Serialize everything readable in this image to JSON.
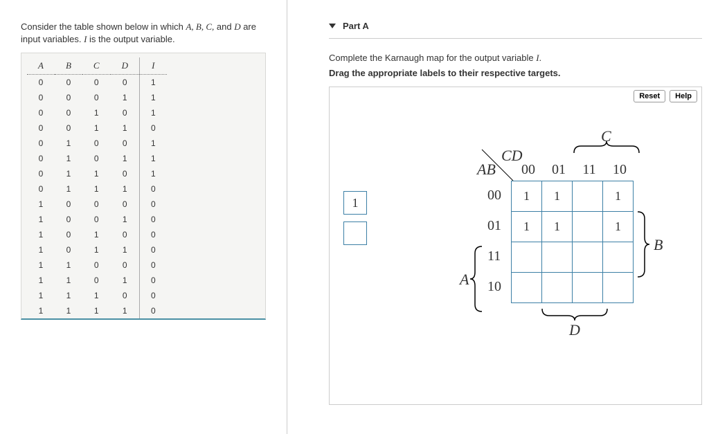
{
  "problem": {
    "text_before": "Consider the table shown below in which ",
    "vars": "A, B, C,",
    "text_mid1": " and ",
    "var_d": "D",
    "text_mid2": " are input variables. ",
    "var_i": "I",
    "text_after": " is the output variable."
  },
  "truth_table": {
    "headers": [
      "A",
      "B",
      "C",
      "D",
      "I"
    ],
    "rows": [
      [
        "0",
        "0",
        "0",
        "0",
        "1"
      ],
      [
        "0",
        "0",
        "0",
        "1",
        "1"
      ],
      [
        "0",
        "0",
        "1",
        "0",
        "1"
      ],
      [
        "0",
        "0",
        "1",
        "1",
        "0"
      ],
      [
        "0",
        "1",
        "0",
        "0",
        "1"
      ],
      [
        "0",
        "1",
        "0",
        "1",
        "1"
      ],
      [
        "0",
        "1",
        "1",
        "0",
        "1"
      ],
      [
        "0",
        "1",
        "1",
        "1",
        "0"
      ],
      [
        "1",
        "0",
        "0",
        "0",
        "0"
      ],
      [
        "1",
        "0",
        "0",
        "1",
        "0"
      ],
      [
        "1",
        "0",
        "1",
        "0",
        "0"
      ],
      [
        "1",
        "0",
        "1",
        "1",
        "0"
      ],
      [
        "1",
        "1",
        "0",
        "0",
        "0"
      ],
      [
        "1",
        "1",
        "0",
        "1",
        "0"
      ],
      [
        "1",
        "1",
        "1",
        "0",
        "0"
      ],
      [
        "1",
        "1",
        "1",
        "1",
        "0"
      ]
    ]
  },
  "part": {
    "title": "Part A",
    "instruction_pre": "Complete the Karnaugh map for the output variable ",
    "instruction_var": "I",
    "instruction_post": ".",
    "drag_instruction": "Drag the appropriate labels to their respective targets."
  },
  "buttons": {
    "reset": "Reset",
    "help": "Help"
  },
  "kmap": {
    "col_header_var": "CD",
    "row_header_var": "AB",
    "top_brace_var": "C",
    "bottom_brace_var": "D",
    "left_brace_var": "A",
    "right_brace_var": "B",
    "col_labels": [
      "00",
      "01",
      "11",
      "10"
    ],
    "row_labels": [
      "00",
      "01",
      "11",
      "10"
    ],
    "cells": [
      [
        "1",
        "1",
        "",
        "1"
      ],
      [
        "1",
        "1",
        "",
        "1"
      ],
      [
        "",
        "",
        "",
        ""
      ],
      [
        "",
        "",
        "",
        ""
      ]
    ]
  },
  "draggable_labels": [
    "1",
    ""
  ]
}
